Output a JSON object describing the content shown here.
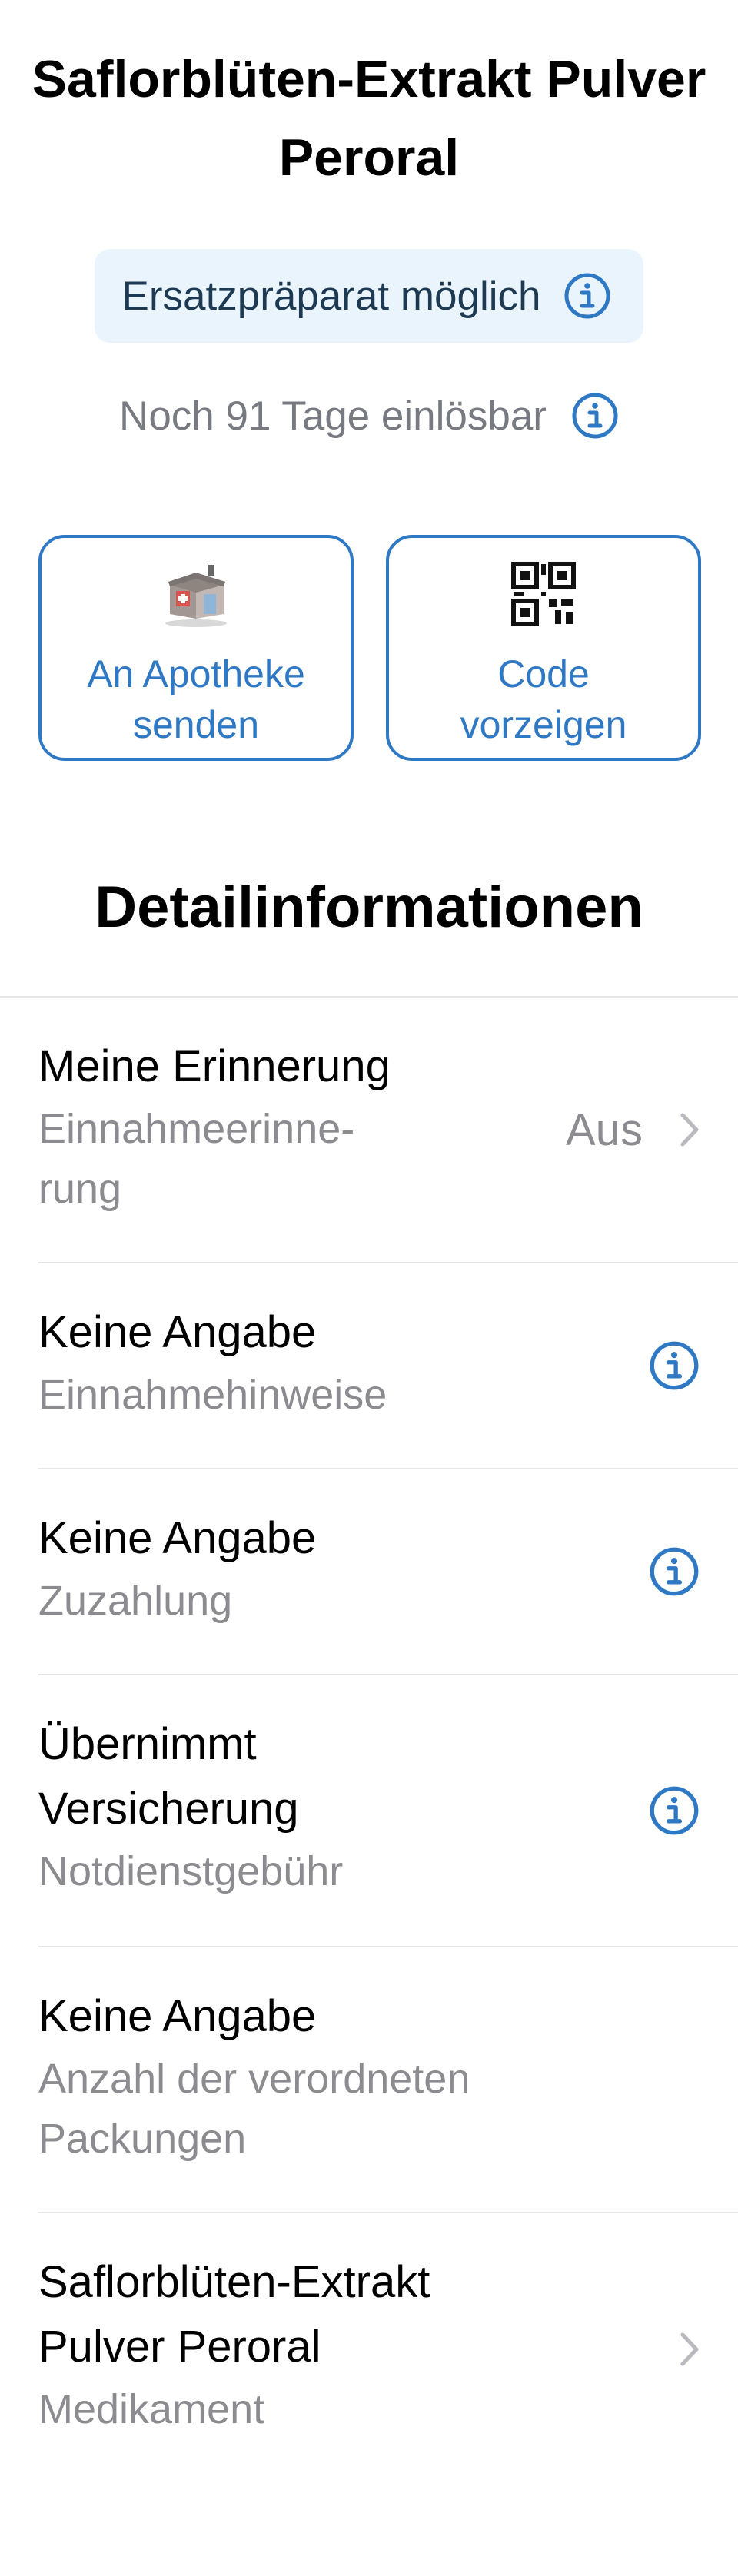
{
  "header": {
    "title": "Saflorblüten-Extrakt Pulver Peroral"
  },
  "substitute_badge": {
    "label": "Ersatzpräparat möglich",
    "icon": "info-icon"
  },
  "validity": {
    "label": "Noch 91 Tage einlösbar",
    "icon": "info-icon"
  },
  "actions": [
    {
      "label_line1": "An Apotheke",
      "label_line2": "senden",
      "icon": "pharmacy-icon"
    },
    {
      "label_line1": "Code",
      "label_line2": "vorzeigen",
      "icon": "qr-code-icon"
    }
  ],
  "details": {
    "title": "Detailinformationen",
    "rows": [
      {
        "primary": "Meine Erinnerung",
        "secondary_line1": "Einnahmeerinne-",
        "secondary_line2": "rung",
        "value": "Aus",
        "accessory": "chevron-right-icon"
      },
      {
        "primary": "Keine Angabe",
        "secondary": "Einnahmehinweise",
        "accessory": "info-icon"
      },
      {
        "primary": "Keine Angabe",
        "secondary": "Zuzahlung",
        "accessory": "info-icon"
      },
      {
        "primary_line1": "Übernimmt",
        "primary_line2": "Versicherung",
        "secondary": "Notdienstgebühr",
        "accessory": "info-icon"
      },
      {
        "primary": "Keine Angabe",
        "secondary_line1": "Anzahl der verordneten",
        "secondary_line2": "Packungen"
      },
      {
        "primary_line1": "Saflorblüten-Extrakt",
        "primary_line2": "Pulver Peroral",
        "secondary": "Medikament",
        "accessory": "chevron-right-icon"
      }
    ]
  },
  "colors": {
    "accent": "#2f78c4",
    "badge_background": "#eaf4fd",
    "secondary_text": "#8b8b90",
    "separator": "#e4e4e6"
  }
}
